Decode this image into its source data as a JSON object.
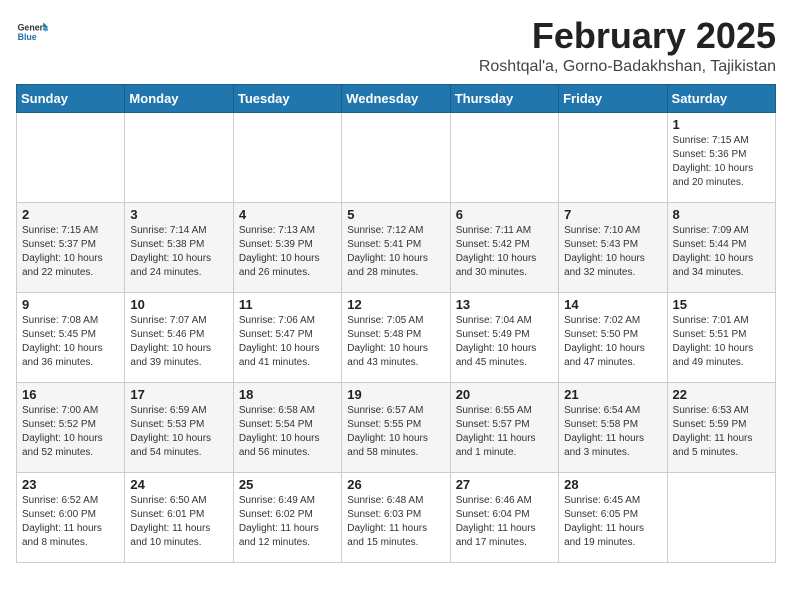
{
  "header": {
    "logo_general": "General",
    "logo_blue": "Blue",
    "month_year": "February 2025",
    "location": "Roshtqal'a, Gorno-Badakhshan, Tajikistan"
  },
  "weekdays": [
    "Sunday",
    "Monday",
    "Tuesday",
    "Wednesday",
    "Thursday",
    "Friday",
    "Saturday"
  ],
  "weeks": [
    [
      {
        "day": "",
        "info": ""
      },
      {
        "day": "",
        "info": ""
      },
      {
        "day": "",
        "info": ""
      },
      {
        "day": "",
        "info": ""
      },
      {
        "day": "",
        "info": ""
      },
      {
        "day": "",
        "info": ""
      },
      {
        "day": "1",
        "info": "Sunrise: 7:15 AM\nSunset: 5:36 PM\nDaylight: 10 hours and 20 minutes."
      }
    ],
    [
      {
        "day": "2",
        "info": "Sunrise: 7:15 AM\nSunset: 5:37 PM\nDaylight: 10 hours and 22 minutes."
      },
      {
        "day": "3",
        "info": "Sunrise: 7:14 AM\nSunset: 5:38 PM\nDaylight: 10 hours and 24 minutes."
      },
      {
        "day": "4",
        "info": "Sunrise: 7:13 AM\nSunset: 5:39 PM\nDaylight: 10 hours and 26 minutes."
      },
      {
        "day": "5",
        "info": "Sunrise: 7:12 AM\nSunset: 5:41 PM\nDaylight: 10 hours and 28 minutes."
      },
      {
        "day": "6",
        "info": "Sunrise: 7:11 AM\nSunset: 5:42 PM\nDaylight: 10 hours and 30 minutes."
      },
      {
        "day": "7",
        "info": "Sunrise: 7:10 AM\nSunset: 5:43 PM\nDaylight: 10 hours and 32 minutes."
      },
      {
        "day": "8",
        "info": "Sunrise: 7:09 AM\nSunset: 5:44 PM\nDaylight: 10 hours and 34 minutes."
      }
    ],
    [
      {
        "day": "9",
        "info": "Sunrise: 7:08 AM\nSunset: 5:45 PM\nDaylight: 10 hours and 36 minutes."
      },
      {
        "day": "10",
        "info": "Sunrise: 7:07 AM\nSunset: 5:46 PM\nDaylight: 10 hours and 39 minutes."
      },
      {
        "day": "11",
        "info": "Sunrise: 7:06 AM\nSunset: 5:47 PM\nDaylight: 10 hours and 41 minutes."
      },
      {
        "day": "12",
        "info": "Sunrise: 7:05 AM\nSunset: 5:48 PM\nDaylight: 10 hours and 43 minutes."
      },
      {
        "day": "13",
        "info": "Sunrise: 7:04 AM\nSunset: 5:49 PM\nDaylight: 10 hours and 45 minutes."
      },
      {
        "day": "14",
        "info": "Sunrise: 7:02 AM\nSunset: 5:50 PM\nDaylight: 10 hours and 47 minutes."
      },
      {
        "day": "15",
        "info": "Sunrise: 7:01 AM\nSunset: 5:51 PM\nDaylight: 10 hours and 49 minutes."
      }
    ],
    [
      {
        "day": "16",
        "info": "Sunrise: 7:00 AM\nSunset: 5:52 PM\nDaylight: 10 hours and 52 minutes."
      },
      {
        "day": "17",
        "info": "Sunrise: 6:59 AM\nSunset: 5:53 PM\nDaylight: 10 hours and 54 minutes."
      },
      {
        "day": "18",
        "info": "Sunrise: 6:58 AM\nSunset: 5:54 PM\nDaylight: 10 hours and 56 minutes."
      },
      {
        "day": "19",
        "info": "Sunrise: 6:57 AM\nSunset: 5:55 PM\nDaylight: 10 hours and 58 minutes."
      },
      {
        "day": "20",
        "info": "Sunrise: 6:55 AM\nSunset: 5:57 PM\nDaylight: 11 hours and 1 minute."
      },
      {
        "day": "21",
        "info": "Sunrise: 6:54 AM\nSunset: 5:58 PM\nDaylight: 11 hours and 3 minutes."
      },
      {
        "day": "22",
        "info": "Sunrise: 6:53 AM\nSunset: 5:59 PM\nDaylight: 11 hours and 5 minutes."
      }
    ],
    [
      {
        "day": "23",
        "info": "Sunrise: 6:52 AM\nSunset: 6:00 PM\nDaylight: 11 hours and 8 minutes."
      },
      {
        "day": "24",
        "info": "Sunrise: 6:50 AM\nSunset: 6:01 PM\nDaylight: 11 hours and 10 minutes."
      },
      {
        "day": "25",
        "info": "Sunrise: 6:49 AM\nSunset: 6:02 PM\nDaylight: 11 hours and 12 minutes."
      },
      {
        "day": "26",
        "info": "Sunrise: 6:48 AM\nSunset: 6:03 PM\nDaylight: 11 hours and 15 minutes."
      },
      {
        "day": "27",
        "info": "Sunrise: 6:46 AM\nSunset: 6:04 PM\nDaylight: 11 hours and 17 minutes."
      },
      {
        "day": "28",
        "info": "Sunrise: 6:45 AM\nSunset: 6:05 PM\nDaylight: 11 hours and 19 minutes."
      },
      {
        "day": "",
        "info": ""
      }
    ]
  ]
}
